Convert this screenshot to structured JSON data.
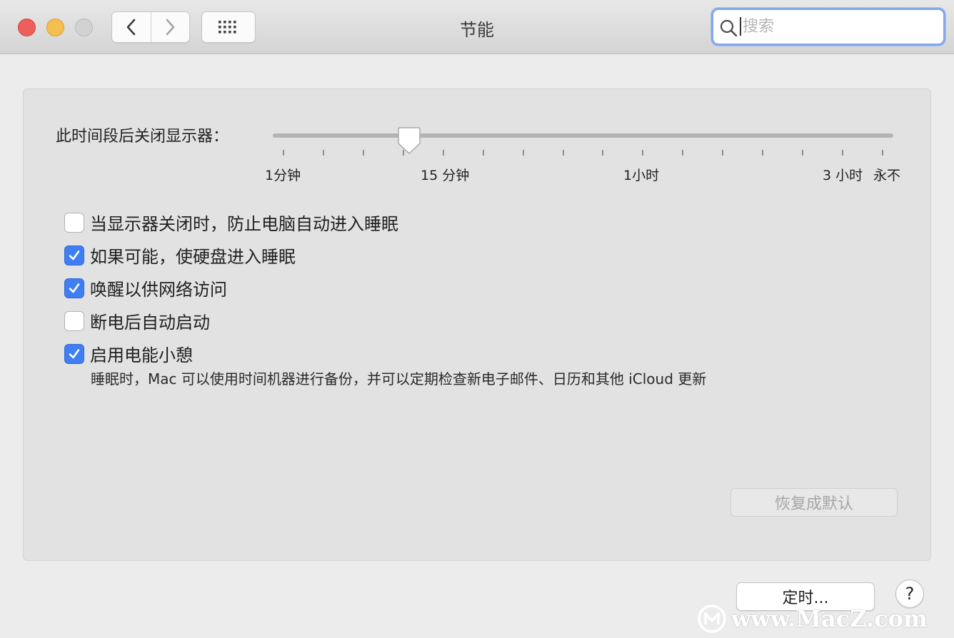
{
  "window": {
    "title": "节能",
    "search_placeholder": "搜索"
  },
  "slider": {
    "label": "此时间段后关闭显示器：",
    "selected_value": "15 分钟",
    "position_fraction": 0.21,
    "tick_count": 16,
    "tick_labels": [
      "1分钟",
      "15 分钟",
      "1小时",
      "3 小时",
      "永不"
    ]
  },
  "options": [
    {
      "label": "当显示器关闭时，防止电脑自动进入睡眠",
      "checked": false
    },
    {
      "label": "如果可能，使硬盘进入睡眠",
      "checked": true
    },
    {
      "label": "唤醒以供网络访问",
      "checked": true
    },
    {
      "label": "断电后自动启动",
      "checked": false
    },
    {
      "label": "启用电能小憩",
      "checked": true
    }
  ],
  "power_nap_description": "睡眠时，Mac 可以使用时间机器进行备份，并可以定期检查新电子邮件、日历和其他 iCloud 更新",
  "buttons": {
    "restore_defaults": "恢复成默认",
    "schedule": "定时...",
    "help": "?"
  },
  "watermark": "www.MacZ.com",
  "colors": {
    "accent": "#3f7ff3",
    "close": "#ed5f5a",
    "minimize": "#f5be4f",
    "zoom_disabled": "#d2d2d2",
    "search_focus": "#83a7ea"
  },
  "icons": [
    "back-chevron-icon",
    "forward-chevron-icon",
    "grid-icon",
    "search-icon",
    "checkmark-icon",
    "slider-thumb-icon"
  ]
}
